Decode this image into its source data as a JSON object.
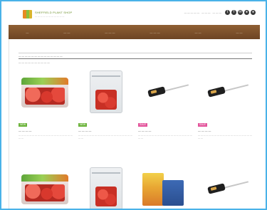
{
  "header": {
    "logo_title": "SHEFFIELD PLANT SHOP",
    "logo_subtitle": "— — — — — — — — — — —",
    "links": [
      "— — — — —",
      "— — —",
      "— — —"
    ],
    "icons": [
      "twitter-icon",
      "facebook-icon",
      "mail-icon",
      "cart-icon",
      "user-icon"
    ]
  },
  "nav": {
    "items": [
      "—",
      "— —",
      "— — —",
      "— — —",
      "— —",
      "— —"
    ]
  },
  "breadcrumb": "— — — — — — — — — — — — — —",
  "section_title": "— — — — — — — — — —",
  "products": [
    {
      "badge": "NEW",
      "badge_color": "#6bb33a",
      "name": "— — — —",
      "desc": "— — — — — — — — — — — — — — — — — — — — — —",
      "image": "strawberry-tray"
    },
    {
      "badge": "NEW",
      "badge_color": "#6bb33a",
      "name": "— — — —",
      "desc": "— — — — — — — — — — — — — — — — — — — — — —",
      "image": "cherry-bag"
    },
    {
      "badge": "SALE",
      "badge_color": "#e3549b",
      "name": "— — — —",
      "desc": "— — — — — — — — — — — — — — — — — — — — — —",
      "image": "pruning-tool"
    },
    {
      "badge": "SALE",
      "badge_color": "#e3549b",
      "name": "— — — —",
      "desc": "— — — — — — — — — — — — — — — — — — — — — —",
      "image": "pruning-tool"
    },
    {
      "image": "strawberry-tray"
    },
    {
      "image": "cherry-bag"
    },
    {
      "image": "orange-package"
    },
    {
      "image": "pruning-tool"
    }
  ],
  "colors": {
    "frame_border": "#4ab2e8",
    "nav_background": "#7a4d28",
    "badge_green": "#6bb33a",
    "badge_pink": "#e3549b"
  }
}
